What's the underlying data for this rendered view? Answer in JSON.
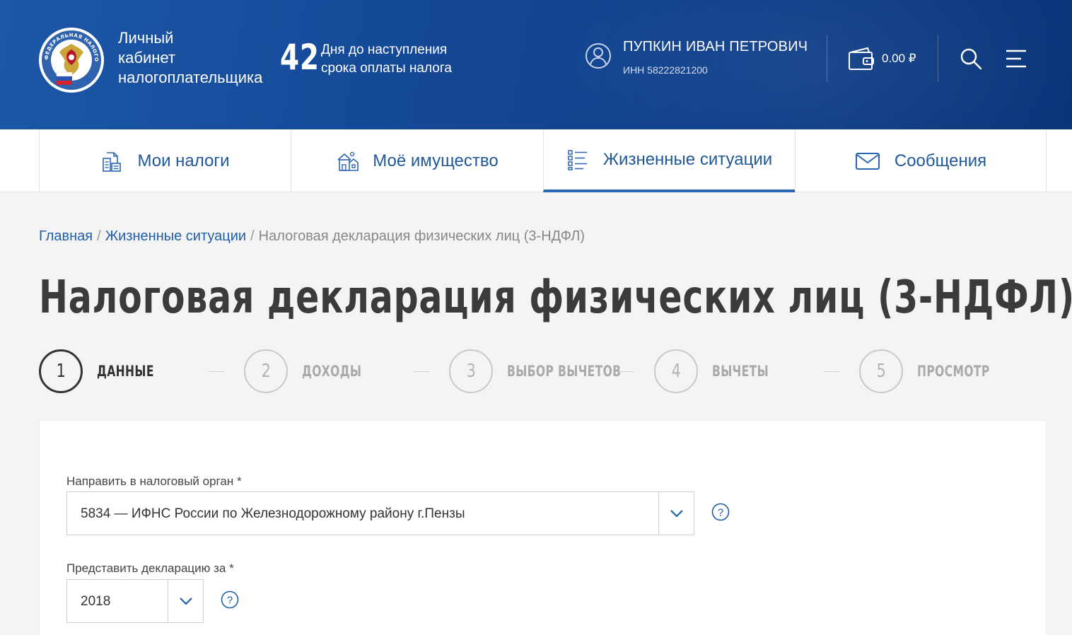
{
  "header": {
    "brand_line1": "Личный",
    "brand_line2": "кабинет",
    "brand_line3": "налогоплательщика",
    "days_count": "42",
    "days_text_line1": "Дня до наступления",
    "days_text_line2": "срока оплаты налога",
    "user_name": "ПУПКИН ИВАН ПЕТРОВИЧ",
    "user_inn": "ИНН 58222821200",
    "balance": "0.00 ₽",
    "logo_text": "ФЕДЕРАЛЬНАЯ НАЛОГОВАЯ СЛУЖБА",
    "colors": {
      "primary": "#154a98",
      "accent": "#2a66b3"
    }
  },
  "nav": {
    "items": [
      {
        "label": "Мои налоги",
        "icon": "documents-icon"
      },
      {
        "label": "Моё имущество",
        "icon": "property-icon"
      },
      {
        "label": "Жизненные ситуации",
        "icon": "list-icon",
        "active": true
      },
      {
        "label": "Сообщения",
        "icon": "envelope-icon"
      }
    ]
  },
  "breadcrumb": {
    "home": "Главная",
    "sep1": "/",
    "section": "Жизненные ситуации",
    "sep2": "/",
    "current": "Налоговая декларация физических лиц (3-НДФЛ)"
  },
  "page_title": "Налоговая декларация физических лиц (3-НДФЛ)",
  "steps": [
    {
      "number": "1",
      "label": "ДАННЫЕ",
      "active": true
    },
    {
      "number": "2",
      "label": "ДОХОДЫ"
    },
    {
      "number": "3",
      "label": "ВЫБОР ВЫЧЕТОВ"
    },
    {
      "number": "4",
      "label": "ВЫЧЕТЫ"
    },
    {
      "number": "5",
      "label": "ПРОСМОТР"
    }
  ],
  "form": {
    "tax_office_label": "Направить в налоговый орган *",
    "tax_office_value": "5834 — ИФНС России по Железнодорожному району г.Пензы",
    "year_label": "Представить декларацию за *",
    "year_value": "2018"
  }
}
